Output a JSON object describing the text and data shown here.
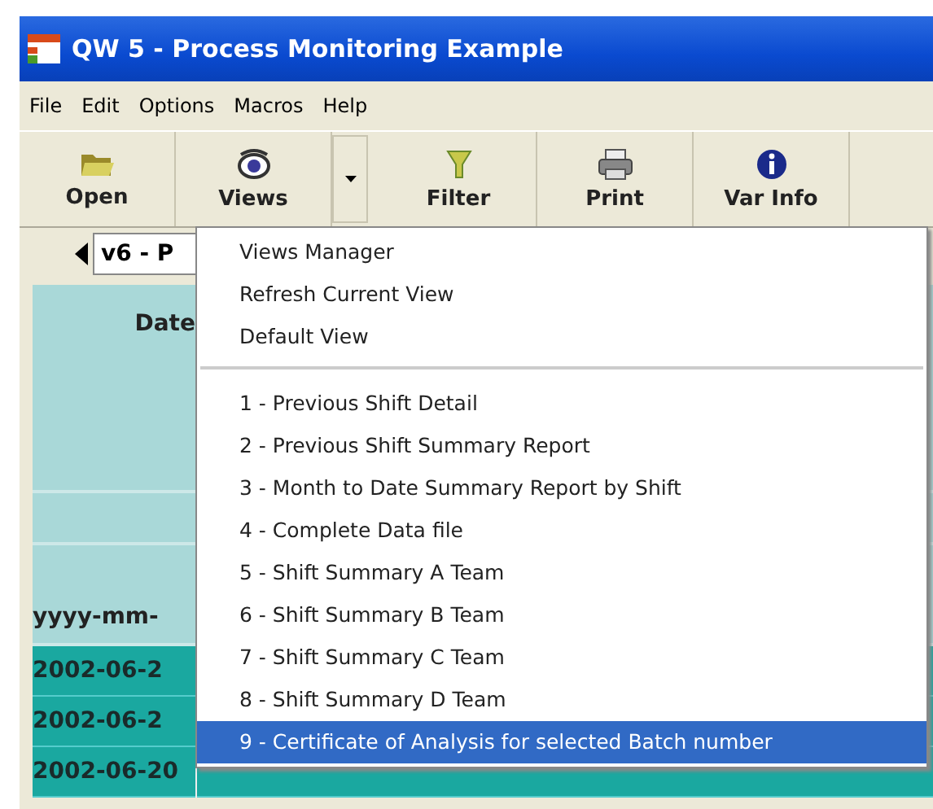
{
  "window": {
    "title": "QW 5 - Process Monitoring Example"
  },
  "menu_bar": [
    "File",
    "Edit",
    "Options",
    "Macros",
    "Help"
  ],
  "toolbar": [
    {
      "label": "Open",
      "kind": "open"
    },
    {
      "label": "Views",
      "kind": "views",
      "has_dropdown": true
    },
    {
      "label": "Filter",
      "kind": "filter"
    },
    {
      "label": "Print",
      "kind": "print"
    },
    {
      "label": "Var Info",
      "kind": "info"
    }
  ],
  "view_selector": {
    "value": "v6 - P"
  },
  "table": {
    "header": "Date",
    "format": "yyyy-mm-",
    "rows": [
      "2002-06-2",
      "2002-06-2",
      "2002-06-20"
    ]
  },
  "views_menu": {
    "sections": [
      {
        "items": [
          {
            "label": "Views Manager",
            "selected": false
          },
          {
            "label": "Refresh Current View",
            "selected": false
          },
          {
            "label": "Default View",
            "selected": false
          }
        ]
      },
      {
        "items": [
          {
            "label": "1 - Previous Shift Detail",
            "selected": false
          },
          {
            "label": "2 - Previous Shift Summary Report",
            "selected": false
          },
          {
            "label": "3 - Month to Date Summary Report by Shift",
            "selected": false
          },
          {
            "label": "4 - Complete Data file",
            "selected": false
          },
          {
            "label": "5 - Shift Summary A Team",
            "selected": false
          },
          {
            "label": "6 - Shift Summary B Team",
            "selected": false
          },
          {
            "label": "7 - Shift Summary C Team",
            "selected": false
          },
          {
            "label": "8 - Shift Summary D Team",
            "selected": false
          },
          {
            "label": "9 - Certificate of Analysis for selected Batch number",
            "selected": true
          }
        ]
      }
    ]
  }
}
